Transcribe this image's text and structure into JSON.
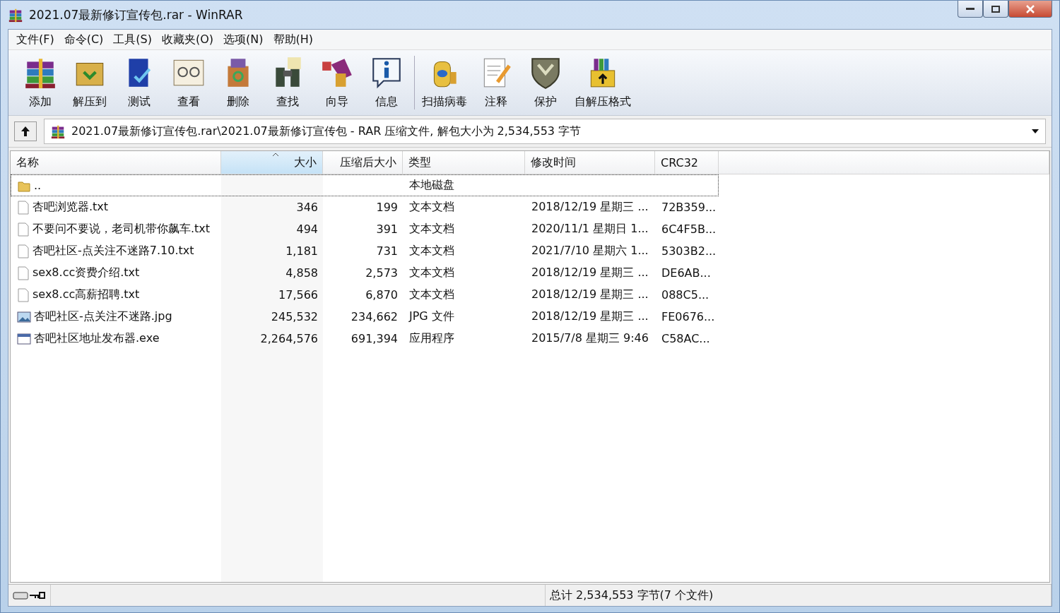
{
  "window": {
    "title": "2021.07最新修订宣传包.rar - WinRAR"
  },
  "menu": [
    "文件(F)",
    "命令(C)",
    "工具(S)",
    "收藏夹(O)",
    "选项(N)",
    "帮助(H)"
  ],
  "toolbar": [
    {
      "label": "添加"
    },
    {
      "label": "解压到"
    },
    {
      "label": "测试"
    },
    {
      "label": "查看"
    },
    {
      "label": "删除"
    },
    {
      "label": "查找"
    },
    {
      "label": "向导"
    },
    {
      "label": "信息"
    },
    {
      "label": "扫描病毒"
    },
    {
      "label": "注释"
    },
    {
      "label": "保护"
    },
    {
      "label": "自解压格式"
    }
  ],
  "address": {
    "path": "2021.07最新修订宣传包.rar\\2021.07最新修订宣传包 - RAR 压缩文件, 解包大小为 2,534,553 字节"
  },
  "table": {
    "columns": [
      {
        "label": "名称",
        "selected": false
      },
      {
        "label": "大小",
        "selected": true
      },
      {
        "label": "压缩后大小",
        "selected": false
      },
      {
        "label": "类型",
        "selected": false
      },
      {
        "label": "修改时间",
        "selected": false
      },
      {
        "label": "CRC32",
        "selected": false
      }
    ],
    "rows": [
      {
        "kind": "folder",
        "focused": true,
        "cells": [
          "..",
          "",
          "",
          "本地磁盘",
          "",
          ""
        ]
      },
      {
        "kind": "txt",
        "focused": false,
        "cells": [
          "杏吧浏览器.txt",
          "346",
          "199",
          "文本文档",
          "2018/12/19 星期三 ...",
          "72B359..."
        ]
      },
      {
        "kind": "txt",
        "focused": false,
        "cells": [
          "不要问不要说，老司机带你飙车.txt",
          "494",
          "391",
          "文本文档",
          "2020/11/1 星期日 1...",
          "6C4F5B..."
        ]
      },
      {
        "kind": "txt",
        "focused": false,
        "cells": [
          "杏吧社区-点关注不迷路7.10.txt",
          "1,181",
          "731",
          "文本文档",
          "2021/7/10 星期六 1...",
          "5303B2..."
        ]
      },
      {
        "kind": "txt",
        "focused": false,
        "cells": [
          "sex8.cc资费介绍.txt",
          "4,858",
          "2,573",
          "文本文档",
          "2018/12/19 星期三 ...",
          "DE6AB..."
        ]
      },
      {
        "kind": "txt",
        "focused": false,
        "cells": [
          "sex8.cc高薪招聘.txt",
          "17,566",
          "6,870",
          "文本文档",
          "2018/12/19 星期三 ...",
          "088C5..."
        ]
      },
      {
        "kind": "jpg",
        "focused": false,
        "cells": [
          "杏吧社区-点关注不迷路.jpg",
          "245,532",
          "234,662",
          "JPG 文件",
          "2018/12/19 星期三 ...",
          "FE0676..."
        ]
      },
      {
        "kind": "exe",
        "focused": false,
        "cells": [
          "杏吧社区地址发布器.exe",
          "2,264,576",
          "691,394",
          "应用程序",
          "2015/7/8 星期三 9:46",
          "C58AC..."
        ]
      }
    ]
  },
  "status_bar": {
    "total": "总计 2,534,553 字节(7 个文件)"
  }
}
